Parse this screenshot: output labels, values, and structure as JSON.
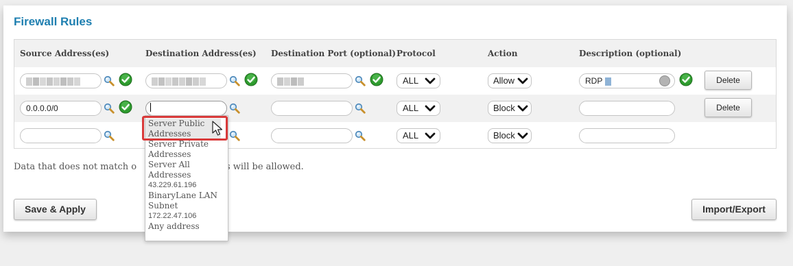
{
  "title": "Firewall Rules",
  "headers": {
    "source": "Source Address(es)",
    "destination": "Destination Address(es)",
    "port": "Destination Port (optional)",
    "protocol": "Protocol",
    "action": "Action",
    "description": "Description (optional)"
  },
  "rows": [
    {
      "source": "",
      "source_redacted": true,
      "destination": "",
      "destination_redacted": true,
      "port": "",
      "port_redacted": true,
      "protocol": "ALL",
      "action": "Allow",
      "description": "RDP",
      "delete": "Delete"
    },
    {
      "source": "0.0.0.0/0",
      "destination": "",
      "port": "",
      "protocol": "ALL",
      "action": "Block",
      "description": "",
      "delete": "Delete"
    },
    {
      "source": "",
      "destination": "",
      "port": "",
      "protocol": "ALL",
      "action": "Block",
      "description": ""
    }
  ],
  "dropdown_options": [
    "Server Public Addresses",
    "Server Private Addresses",
    "Server All Addresses",
    "43.229.61.196",
    "BinaryLane LAN Subnet",
    "172.22.47.106",
    "Any address"
  ],
  "note_left": "Data that does not match o",
  "note_right": "les will be allowed.",
  "buttons": {
    "save": "Save & Apply",
    "import_export": "Import/Export"
  },
  "colors": {
    "accent": "#1e7fb0",
    "valid": "#2e9b2e",
    "highlight": "#d93a3a"
  },
  "icons": {
    "lookup": "magnifier-icon",
    "valid": "green-check-icon"
  }
}
